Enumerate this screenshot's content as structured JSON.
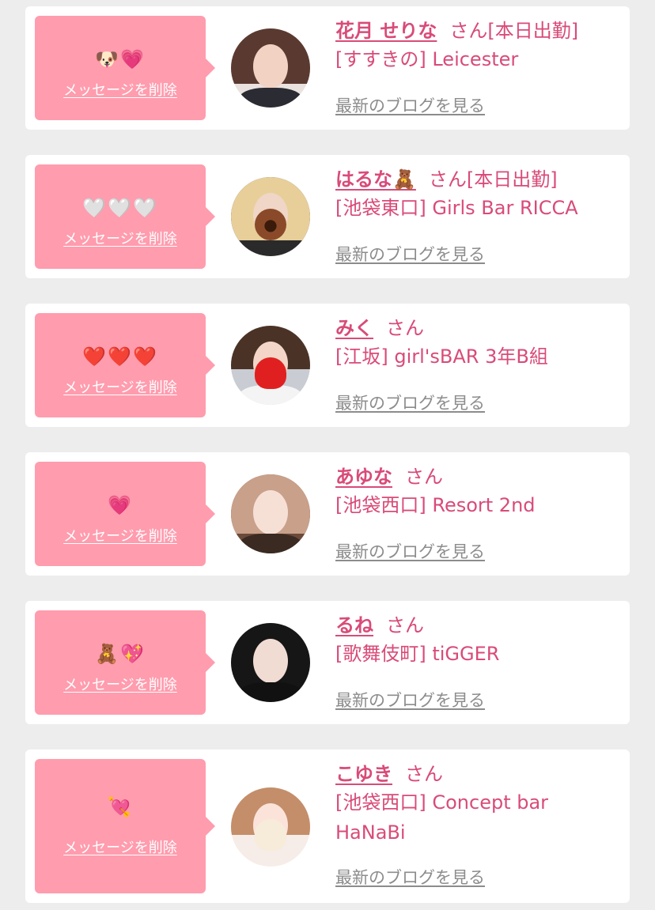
{
  "colors": {
    "background": "#ededed",
    "card": "#ffffff",
    "bubble": "#ff9cae",
    "accent_text": "#d94b78",
    "link_gray": "#8c8c8c"
  },
  "messages": [
    {
      "emoji": "🐶💗",
      "delete_label": "メッセージを削除",
      "name": "花月 せりな",
      "suffix": "さん[本日出勤]",
      "shop_line_1": "[すすきの] Leicester",
      "shop_line_2": "",
      "blog_label": "最新のブログを見る"
    },
    {
      "emoji": "🤍🤍🤍",
      "delete_label": "メッセージを削除",
      "name": "はるな🧸",
      "suffix": "さん[本日出勤]",
      "shop_line_1": "[池袋東口] Girls Bar RICCA",
      "shop_line_2": "",
      "blog_label": "最新のブログを見る"
    },
    {
      "emoji": "❤️❤️❤️",
      "delete_label": "メッセージを削除",
      "name": "みく",
      "suffix": "さん",
      "shop_line_1": "[江坂] girl'sBAR 3年B組",
      "shop_line_2": "",
      "blog_label": "最新のブログを見る"
    },
    {
      "emoji": "💗",
      "delete_label": "メッセージを削除",
      "name": "あゆな",
      "suffix": "さん",
      "shop_line_1": "[池袋西口] Resort 2nd",
      "shop_line_2": "",
      "blog_label": "最新のブログを見る"
    },
    {
      "emoji": "🧸💖",
      "delete_label": "メッセージを削除",
      "name": "るね",
      "suffix": "さん",
      "shop_line_1": "[歌舞伎町] tiGGER",
      "shop_line_2": "",
      "blog_label": "最新のブログを見る"
    },
    {
      "emoji": "💘",
      "delete_label": "メッセージを削除",
      "name": "こゆき",
      "suffix": "さん",
      "shop_line_1": "[池袋西口] Concept bar",
      "shop_line_2": "HaNaBi",
      "blog_label": "最新のブログを見る"
    }
  ]
}
